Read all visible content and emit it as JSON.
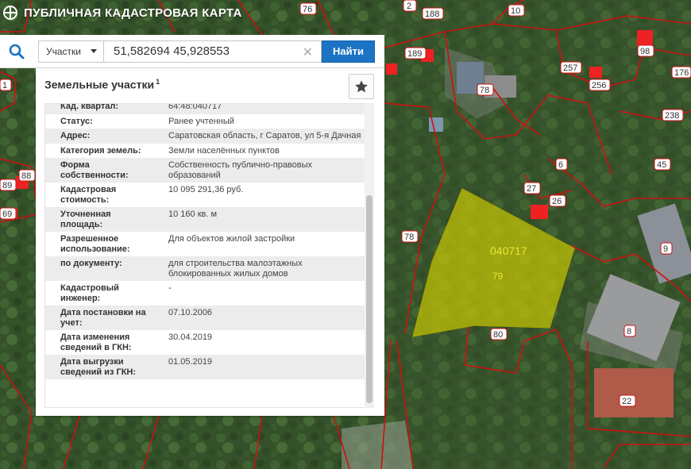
{
  "app": {
    "title": "ПУБЛИЧНАЯ КАДАСТРОВАЯ КАРТА"
  },
  "search": {
    "type_label": "Участки",
    "query": "51,582694 45,928553",
    "clear_symbol": "✕",
    "button_label": "Найти"
  },
  "panel": {
    "title": "Земельные участки",
    "title_sup": "1",
    "rows": [
      {
        "label": "Кад. квартал:",
        "value": "64:48:040717",
        "link": true
      },
      {
        "label": "Статус:",
        "value": "Ранее учтенный"
      },
      {
        "label": "Адрес:",
        "value": "Саратовская область, г Саратов, ул 5-я Дачная"
      },
      {
        "label": "Категория земель:",
        "value": "Земли населённых пунктов"
      },
      {
        "label": "Форма собственности:",
        "value": "Собственность публично-правовых образований"
      },
      {
        "label": "Кадастровая стоимость:",
        "value": "10 095 291,36 руб."
      },
      {
        "label": "Уточненная площадь:",
        "value": "10 160 кв. м"
      },
      {
        "label": "Разрешенное использование:",
        "value": "Для объектов жилой застройки"
      },
      {
        "label": "по документу:",
        "value": "для строительства малоэтажных блокированных жилых домов"
      },
      {
        "label": "Кадастровый инженер:",
        "value": "-"
      },
      {
        "label": "Дата постановки на учет:",
        "value": "07.10.2006"
      },
      {
        "label": "Дата изменения сведений в ГКН:",
        "value": "30.04.2019"
      },
      {
        "label": "Дата выгрузки сведений из ГКН:",
        "value": "01.05.2019"
      }
    ]
  },
  "map": {
    "parcel_code": "040717",
    "parcel_number": "79",
    "labels": [
      "76",
      "2",
      "188",
      "10",
      "189",
      "98",
      "257",
      "256",
      "176",
      "78",
      "238",
      "45",
      "9",
      "6",
      "27",
      "26",
      "78",
      "80",
      "8",
      "22",
      "88",
      "89",
      "69",
      "1"
    ]
  },
  "colors": {
    "accent": "#1a73c3",
    "parcel_fill": "#d4d000",
    "boundary": "#cc1111",
    "forest": "#2f4a22"
  }
}
